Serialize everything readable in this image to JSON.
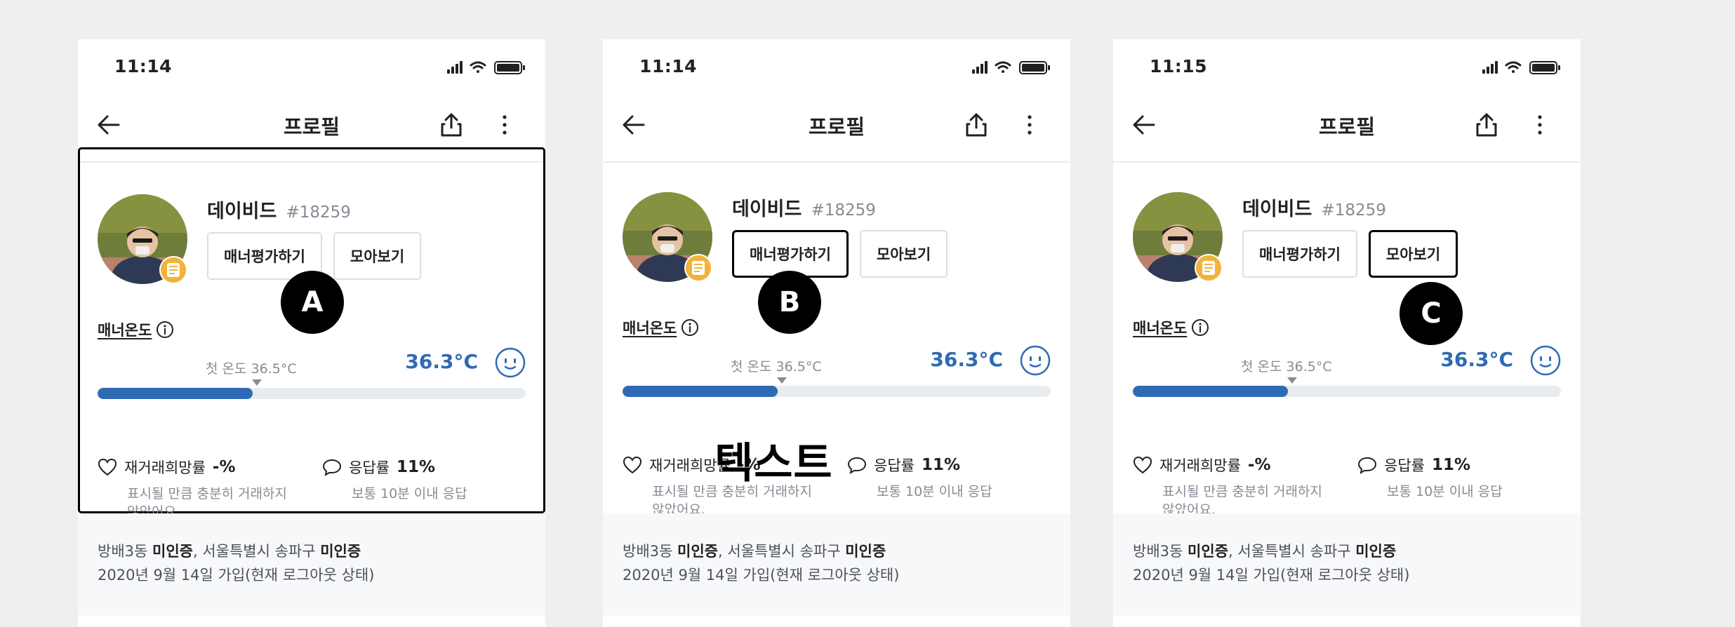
{
  "phones": [
    {
      "time": "11:14",
      "title": "프로필",
      "nickname": "데이비드",
      "user_id": "#18259",
      "manner_eval_label": "매너평가하기",
      "collection_label": "모아보기",
      "manner_temp_label": "매너온도",
      "first_temp_label": "첫 온도 36.5°C",
      "temp_value": "36.3°C",
      "temp_percent": 36.3,
      "rehire_label": "재거래희망률",
      "rehire_value": "-%",
      "rehire_desc": "표시될 만큼 충분히 거래하지 않았어요.",
      "response_label": "응답률",
      "response_value": "11%",
      "response_desc": "보통 10분 이내 응답",
      "info_line1": {
        "p1": "방배3동 ",
        "b1": "미인증",
        "p2": ", 서울특별시 송파구 ",
        "b2": "미인증"
      },
      "info_line2": "2020년 9월 14일 가입(현재 로그아웃 상태)",
      "highlight": "card",
      "marker": "A"
    },
    {
      "time": "11:14",
      "title": "프로필",
      "nickname": "데이비드",
      "user_id": "#18259",
      "manner_eval_label": "매너평가하기",
      "collection_label": "모아보기",
      "manner_temp_label": "매너온도",
      "first_temp_label": "첫 온도 36.5°C",
      "temp_value": "36.3°C",
      "temp_percent": 36.3,
      "rehire_label": "재거래희망률",
      "rehire_value": "-%",
      "rehire_desc": "표시될 만큼 충분히 거래하지 않았어요.",
      "response_label": "응답률",
      "response_value": "11%",
      "response_desc": "보통 10분 이내 응답",
      "info_line1": {
        "p1": "방배3동 ",
        "b1": "미인증",
        "p2": ", 서울특별시 송파구 ",
        "b2": "미인증"
      },
      "info_line2": "2020년 9월 14일 가입(현재 로그아웃 상태)",
      "highlight": "manner_button",
      "marker": "B",
      "overlay_text": "텍스트"
    },
    {
      "time": "11:15",
      "title": "프로필",
      "nickname": "데이비드",
      "user_id": "#18259",
      "manner_eval_label": "매너평가하기",
      "collection_label": "모아보기",
      "manner_temp_label": "매너온도",
      "first_temp_label": "첫 온도 36.5°C",
      "temp_value": "36.3°C",
      "temp_percent": 36.3,
      "rehire_label": "재거래희망률",
      "rehire_value": "-%",
      "rehire_desc": "표시될 만큼 충분히 거래하지 않았어요.",
      "response_label": "응답률",
      "response_value": "11%",
      "response_desc": "보통 10분 이내 응답",
      "info_line1": {
        "p1": "방배3동 ",
        "b1": "미인증",
        "p2": ", 서울특별시 송파구 ",
        "b2": "미인증"
      },
      "info_line2": "2020년 9월 14일 가입(현재 로그아웃 상태)",
      "highlight": "collection_button",
      "marker": "C"
    }
  ],
  "colors": {
    "temperature_blue": "#2f6ab4",
    "background": "#efefef",
    "info_bg": "#f7f8f9"
  },
  "icons": [
    "back-arrow-icon",
    "share-icon",
    "more-vertical-icon",
    "info-icon",
    "heart-icon",
    "speech-bubble-icon",
    "smiley-face-icon",
    "signal-icon",
    "wifi-icon",
    "battery-icon"
  ]
}
